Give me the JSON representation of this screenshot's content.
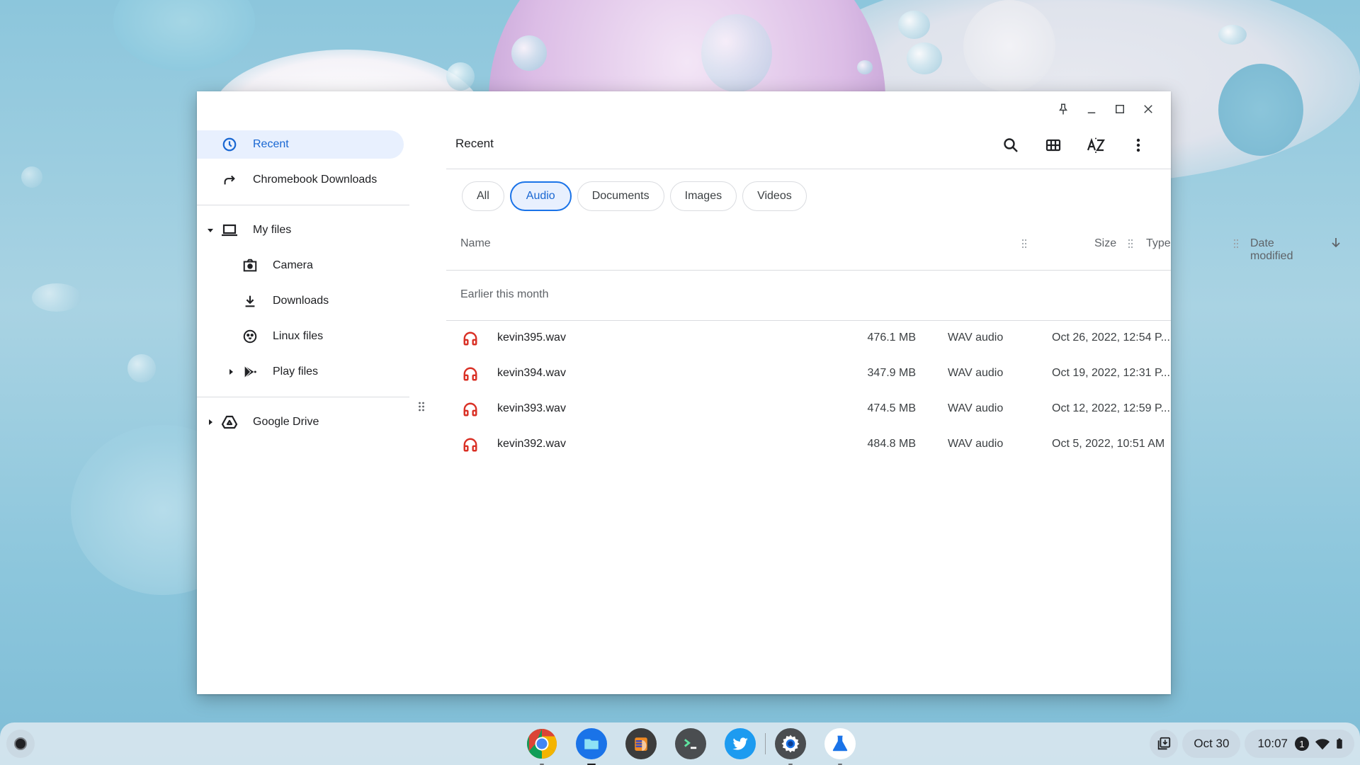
{
  "window": {
    "caption_buttons": [
      {
        "name": "pin",
        "icon": "pin-icon"
      },
      {
        "name": "minimize",
        "icon": "minimize-icon"
      },
      {
        "name": "maximize",
        "icon": "maximize-icon"
      },
      {
        "name": "close",
        "icon": "close-icon"
      }
    ]
  },
  "sidebar": {
    "items": [
      {
        "label": "Recent",
        "icon": "clock-icon",
        "active": true
      },
      {
        "label": "Chromebook Downloads",
        "icon": "shortcut-arrow-icon"
      },
      {
        "label": "My files",
        "icon": "laptop-icon",
        "expanded": true
      },
      {
        "label": "Camera",
        "icon": "camera-icon"
      },
      {
        "label": "Downloads",
        "icon": "download-icon"
      },
      {
        "label": "Linux files",
        "icon": "penguin-icon"
      },
      {
        "label": "Play files",
        "icon": "play-store-icon",
        "expanded": false
      },
      {
        "label": "Google Drive",
        "icon": "google-drive-icon",
        "expanded": false
      }
    ]
  },
  "main": {
    "title": "Recent",
    "toolbar": [
      {
        "name": "search",
        "icon": "search-icon"
      },
      {
        "name": "grid-view",
        "icon": "grid-view-icon"
      },
      {
        "name": "sort",
        "icon": "sort-az-icon"
      },
      {
        "name": "more",
        "icon": "more-vert-icon"
      }
    ],
    "filters": [
      {
        "label": "All",
        "active": false
      },
      {
        "label": "Audio",
        "active": true
      },
      {
        "label": "Documents",
        "active": false
      },
      {
        "label": "Images",
        "active": false
      },
      {
        "label": "Videos",
        "active": false
      }
    ],
    "columns": {
      "name": "Name",
      "size": "Size",
      "type": "Type",
      "date": "Date modified",
      "sort_direction": "descending"
    },
    "group_label": "Earlier this month",
    "files": [
      {
        "name": "kevin395.wav",
        "size": "476.1 MB",
        "type": "WAV audio",
        "date": "Oct 26, 2022, 12:54 P..."
      },
      {
        "name": "kevin394.wav",
        "size": "347.9 MB",
        "type": "WAV audio",
        "date": "Oct 19, 2022, 12:31 P..."
      },
      {
        "name": "kevin393.wav",
        "size": "474.5 MB",
        "type": "WAV audio",
        "date": "Oct 12, 2022, 12:59 P..."
      },
      {
        "name": "kevin392.wav",
        "size": "484.8 MB",
        "type": "WAV audio",
        "date": "Oct 5, 2022, 10:51 AM"
      }
    ],
    "audio_icon_color": "#d93025",
    "accent_color": "#1a73e8"
  },
  "shelf": {
    "apps": [
      {
        "name": "Chrome",
        "icon": "chrome-icon",
        "open": false
      },
      {
        "name": "Files",
        "icon": "files-icon",
        "open": true
      },
      {
        "name": "App",
        "icon": "hand-app-icon",
        "open": false
      },
      {
        "name": "Terminal",
        "icon": "terminal-icon",
        "open": false
      },
      {
        "name": "Twitter",
        "icon": "twitter-icon",
        "open": false
      },
      {
        "name": "Settings",
        "icon": "settings-icon",
        "open": false
      },
      {
        "name": "Canary/Labs",
        "icon": "flask-icon",
        "open": false
      }
    ],
    "date": "Oct 30",
    "time": "10:07",
    "notification_count": "1"
  }
}
